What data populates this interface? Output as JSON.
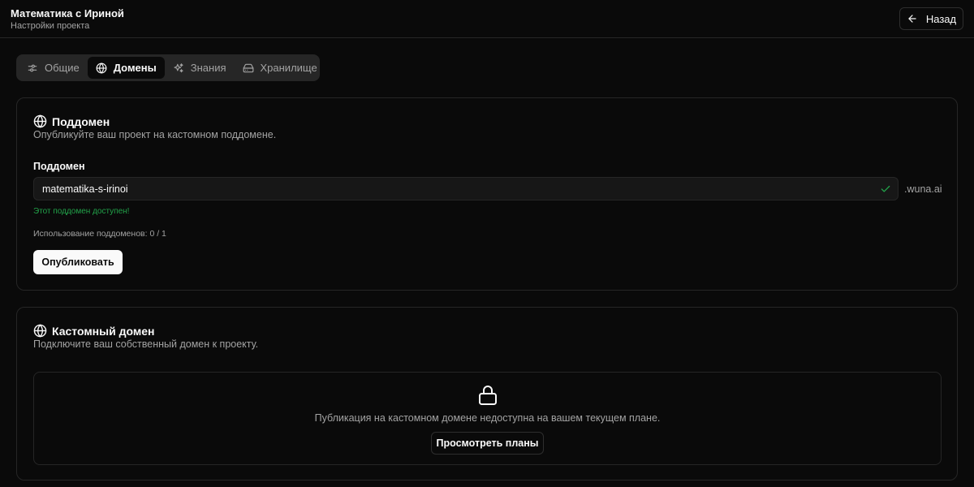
{
  "header": {
    "title": "Математика с Ириной",
    "subtitle": "Настройки проекта",
    "back_label": "Назад"
  },
  "tabs": [
    {
      "label": "Общие",
      "icon": "sliders-icon",
      "active": false
    },
    {
      "label": "Домены",
      "icon": "globe-icon",
      "active": true
    },
    {
      "label": "Знания",
      "icon": "sparkles-icon",
      "active": false
    },
    {
      "label": "Хранилище",
      "icon": "hard-drive-icon",
      "active": false
    }
  ],
  "subdomain_card": {
    "title": "Поддомен",
    "description": "Опубликуйте ваш проект на кастомном поддомене.",
    "field_label": "Поддомен",
    "input_value": "matematika-s-irinoi",
    "suffix": ".wuna.ai",
    "available_message": "Этот поддомен доступен!",
    "usage": "Использование поддоменов: 0 / 1",
    "publish_label": "Опубликовать"
  },
  "custom_domain_card": {
    "title": "Кастомный домен",
    "description": "Подключите ваш собственный домен к проекту.",
    "locked_message": "Публикация на кастомном домене недоступна на вашем текущем плане.",
    "plans_button_label": "Просмотреть планы"
  },
  "colors": {
    "background": "#0a0a0a",
    "border": "#262626",
    "text_primary": "#fafafa",
    "text_muted": "#a3a3a3",
    "success": "#22a34a"
  }
}
